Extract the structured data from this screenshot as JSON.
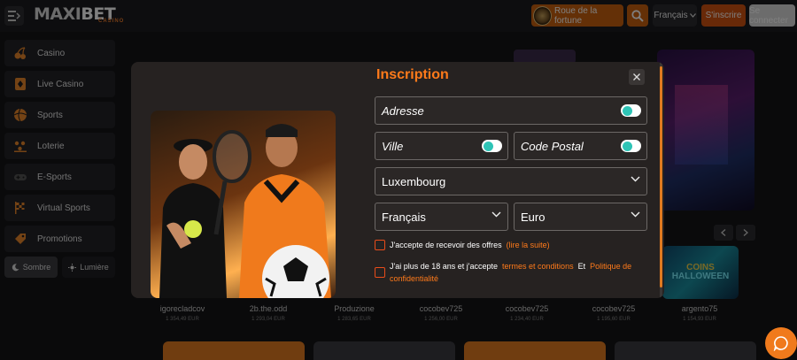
{
  "header": {
    "logo_main": "MAXI",
    "logo_accent": "BET",
    "logo_sub": "CASINO",
    "wheel_label": "Roue de la fortune",
    "language": "Français",
    "signup_label": "S'inscrire",
    "login_label": "Se connecter"
  },
  "sidebar": {
    "items": [
      {
        "label": "Casino",
        "icon": "cherry-icon"
      },
      {
        "label": "Live Casino",
        "icon": "card-icon"
      },
      {
        "label": "Sports",
        "icon": "ball-icon"
      },
      {
        "label": "Loterie",
        "icon": "lottery-icon"
      },
      {
        "label": "E-Sports",
        "icon": "gamepad-icon"
      },
      {
        "label": "Virtual Sports",
        "icon": "flag-icon"
      },
      {
        "label": "Promotions",
        "icon": "tag-icon"
      }
    ],
    "theme_dark": "Sombre",
    "theme_light": "Lumière"
  },
  "background": {
    "game_thumb_line1": "COINS",
    "game_thumb_line2": "HALLOWEEN",
    "winners": [
      {
        "name": "igorecladcov",
        "amount": "1 354,49 EUR"
      },
      {
        "name": "2b.the.odd",
        "amount": "1 293,04 EUR"
      },
      {
        "name": "Produzione",
        "amount": "1 283,65 EUR"
      },
      {
        "name": "cocobev725",
        "amount": "1 256,00 EUR"
      },
      {
        "name": "cocobev725",
        "amount": "1 234,40 EUR"
      },
      {
        "name": "cocobev725",
        "amount": "1 195,60 EUR"
      },
      {
        "name": "argento75",
        "amount": "1 154,93 EUR"
      }
    ]
  },
  "modal": {
    "title": "Inscription",
    "address_label": "Adresse",
    "city_label": "Ville",
    "postal_label": "Code Postal",
    "country_value": "Luxembourg",
    "language_value": "Français",
    "currency_value": "Euro",
    "offers_text": "J'accepte de recevoir des offres",
    "offers_link": "(lire la suite)",
    "age_text": "J'ai plus de 18 ans et j'accepte",
    "terms_link": "termes et conditions",
    "and_text": "Et",
    "privacy_link_1": "Politique de",
    "privacy_link_2": "confidentialité"
  },
  "colors": {
    "accent": "#ff7a1a",
    "brand_orange": "#c9610f",
    "background": "#141416",
    "modal": "#262221"
  }
}
